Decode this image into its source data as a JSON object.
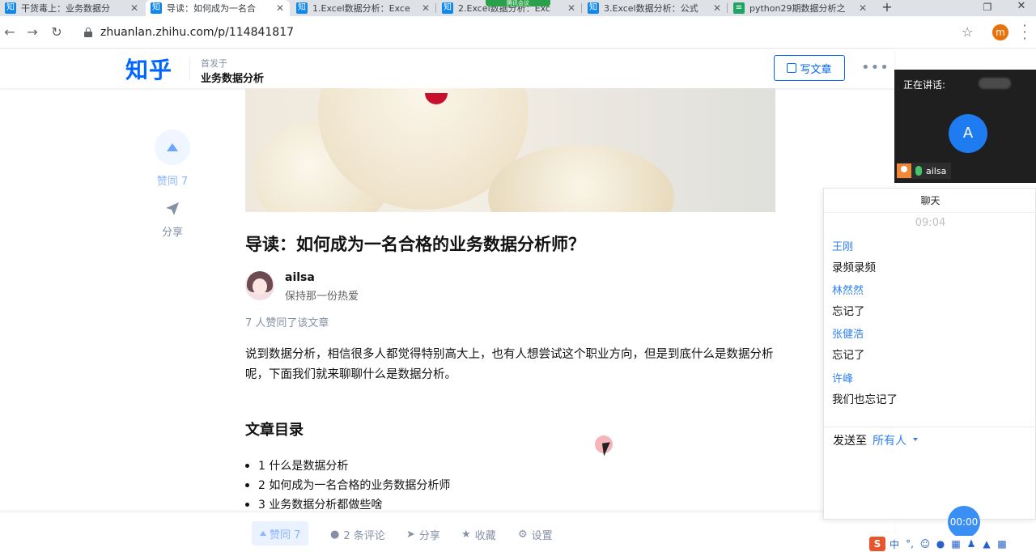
{
  "browser": {
    "tabs": [
      {
        "favicon": "知",
        "title": "干货毒上：业务数据分",
        "active": false
      },
      {
        "favicon": "知",
        "title": "导读：如何成为一名合",
        "active": true
      },
      {
        "favicon": "知",
        "title": "1.Excel数据分析：Exce",
        "active": false
      },
      {
        "favicon": "知",
        "title": "2.Excel数据分析：Exc",
        "active": false
      },
      {
        "favicon": "知",
        "title": "3.Excel数据分析：公式",
        "active": false
      },
      {
        "favicon": "sheet",
        "title": "python29期数据分析之",
        "active": false
      }
    ],
    "close_glyph": "✕",
    "new_tab_glyph": "+",
    "meeting_pill": "腾讯会议",
    "url": "zhuanlan.zhihu.com/p/114841817",
    "profile_initial": "m",
    "icons": [
      "back-icon",
      "forward-icon",
      "reload-icon",
      "lock-icon",
      "star-icon",
      "menu-icon"
    ]
  },
  "zhihu_header": {
    "logo": "知乎",
    "first_on_label": "首发于",
    "column_name": "业务数据分析",
    "write_button": "写文章",
    "more_glyph": "•••"
  },
  "sidebar": {
    "vote_label": "赞同 7",
    "share_label": "分享"
  },
  "article": {
    "title": "导读：如何成为一名合格的业务数据分析师？",
    "author": {
      "name": "ailsa",
      "bio": "保持那一份热爱"
    },
    "vote_count_text": "7 人赞同了该文章",
    "intro": "说到数据分析，相信很多人都觉得特别高大上，也有人想尝试这个职业方向，但是到底什么是数据分析呢，下面我们就来聊聊什么是数据分析。",
    "toc_heading": "文章目录",
    "toc": [
      "1 什么是数据分析",
      "2 如何成为一名合格的业务数据分析师",
      "3 业务数据分析都做些啥"
    ]
  },
  "action_bar": {
    "vote": "赞同 7",
    "comments": "2 条评论",
    "share": "分享",
    "favorite": "收藏",
    "settings": "设置"
  },
  "meeting": {
    "speaking_label": "正在讲话:",
    "avatar_letter": "A",
    "username": "ailsa",
    "timer": "00:00",
    "chat": {
      "title": "聊天",
      "time": "09:04",
      "messages": [
        {
          "sender": "王刚",
          "text": "录频录频"
        },
        {
          "sender": "林然然",
          "text": "忘记了"
        },
        {
          "sender": "张健浩",
          "text": "忘记了"
        },
        {
          "sender": "许峰",
          "text": "我们也忘记了"
        }
      ],
      "send_to_label": "发送至",
      "send_target": "所有人"
    }
  },
  "ime_tray": {
    "logo": "S",
    "mode": "中",
    "punct": "°,"
  },
  "colors": {
    "zhihu_blue": "#0066ff",
    "chat_blue": "#2f80ed",
    "meeting_dark": "#1f1f1f"
  }
}
